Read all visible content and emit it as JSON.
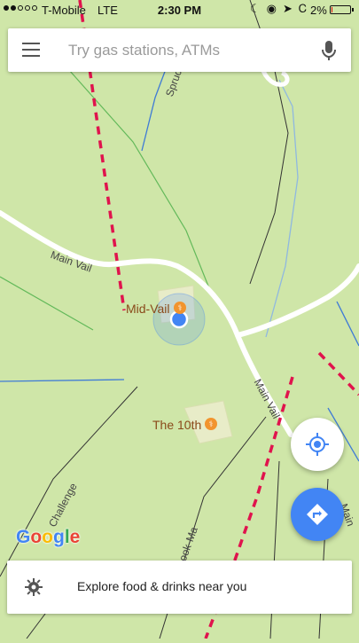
{
  "status_bar": {
    "carrier": "T-Mobile",
    "network": "LTE",
    "time": "2:30 PM",
    "battery": "2%",
    "battery_level": 0.02,
    "signal_bars_filled": 2,
    "icons": [
      "moon-icon",
      "orientation-lock-icon",
      "location-arrow-icon",
      "bluetooth-icon"
    ]
  },
  "search": {
    "placeholder": "Try gas stations, ATMs",
    "menu_icon": "hamburger-menu-icon",
    "mic_icon": "microphone-icon"
  },
  "map": {
    "background_color": "#cfe6a8",
    "roads": [
      {
        "name": "Main Vail",
        "labels": [
          "Main Vail",
          "Main Vail",
          "Main"
        ]
      },
      {
        "name": "Spruce",
        "label": "Spruc"
      },
      {
        "name": "Challenge",
        "label": "Challenge"
      },
      {
        "name": "Cook-Ma",
        "label": "Cook-Ma"
      }
    ],
    "places": [
      {
        "name": "Mid-Vail",
        "category": "restaurant"
      },
      {
        "name": "The 10th",
        "category": "restaurant"
      }
    ],
    "my_location": {
      "accuracy_color": "#4285f4"
    }
  },
  "controls": {
    "locate_icon": "my-location-icon",
    "directions_icon": "directions-icon"
  },
  "logo": "Google",
  "explore": {
    "icon": "gear-icon",
    "label": "Explore food & drinks near you"
  },
  "colors": {
    "accent": "#4285f4",
    "trail_red": "#e0134d",
    "stream_blue": "#3f7bd6",
    "park_green": "#cfe6a8"
  }
}
